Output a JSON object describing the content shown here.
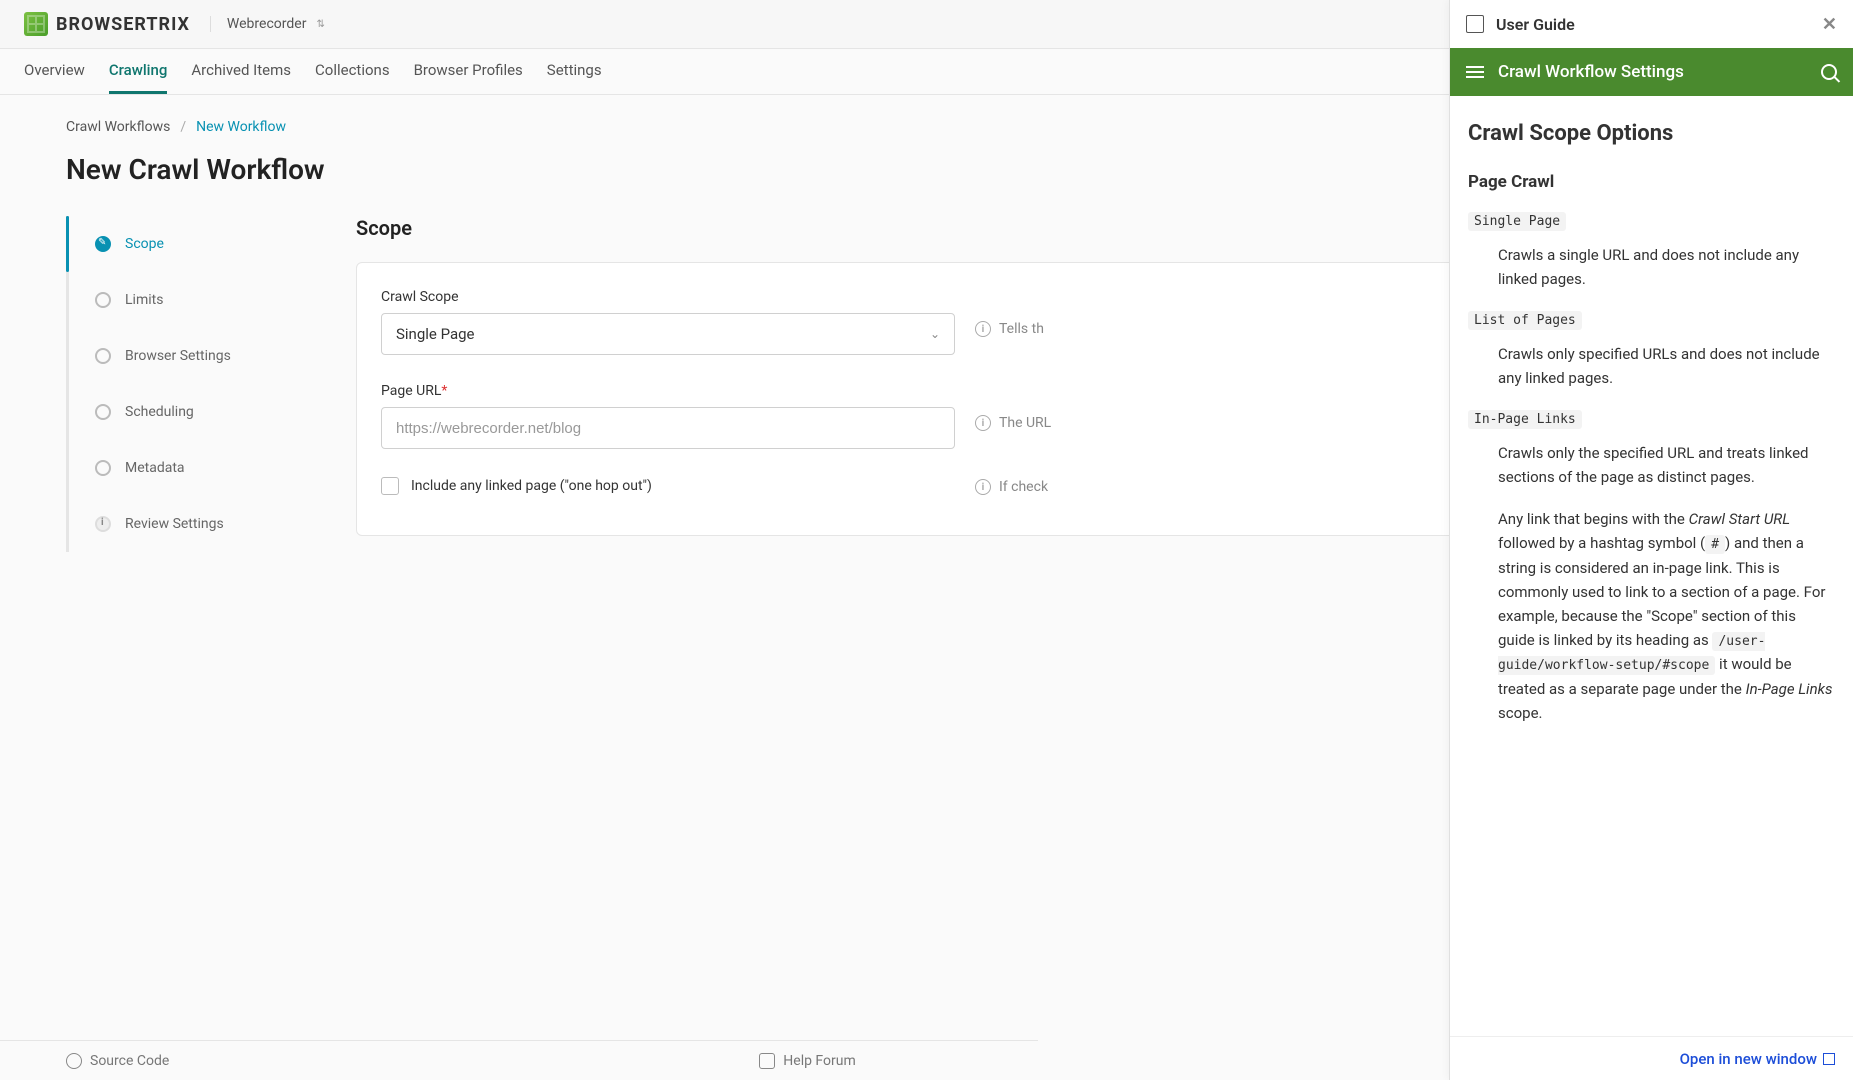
{
  "topbar": {
    "brand": "BROWSERTRIX",
    "org": "Webrecorder"
  },
  "nav": {
    "items": [
      "Overview",
      "Crawling",
      "Archived Items",
      "Collections",
      "Browser Profiles",
      "Settings"
    ],
    "active_index": 1
  },
  "breadcrumb": {
    "parent": "Crawl Workflows",
    "sep": "/",
    "current": "New Workflow"
  },
  "page": {
    "title": "New Crawl Workflow"
  },
  "steps": [
    "Scope",
    "Limits",
    "Browser Settings",
    "Scheduling",
    "Metadata",
    "Review Settings"
  ],
  "section": {
    "heading": "Scope",
    "crawl_scope_label": "Crawl Scope",
    "crawl_scope_value": "Single Page",
    "crawl_scope_help": "Tells th",
    "page_url_label": "Page URL",
    "page_url_placeholder": "https://webrecorder.net/blog",
    "page_url_help": "The URL",
    "linked_label": "Include any linked page (\"one hop out\")",
    "linked_help": "If check"
  },
  "footer": {
    "source": "Source Code",
    "help_forum": "Help Forum"
  },
  "helppanel": {
    "title": "User Guide",
    "green_title": "Crawl Workflow Settings",
    "h1": "Crawl Scope Options",
    "h2": "Page Crawl",
    "opt1_code": "Single Page",
    "opt1_desc": "Crawls a single URL and does not include any linked pages.",
    "opt2_code": "List of Pages",
    "opt2_desc": "Crawls only specified URLs and does not include any linked pages.",
    "opt3_code": "In-Page Links",
    "opt3_desc": "Crawls only the specified URL and treats linked sections of the page as distinct pages.",
    "para_a": "Any link that begins with the ",
    "para_em1": "Crawl Start URL",
    "para_b": " followed by a hashtag symbol (",
    "para_hash": "#",
    "para_c": ") and then a string is considered an in-page link. This is commonly used to link to a section of a page. For example, because the \"Scope\" section of this guide is linked by its heading as ",
    "para_code2": "/user-guide/workflow-setup/#scope",
    "para_d": " it would be treated as a separate page under the ",
    "para_em2": "In-Page Links",
    "para_e": " scope.",
    "open_new": "Open in new window"
  }
}
